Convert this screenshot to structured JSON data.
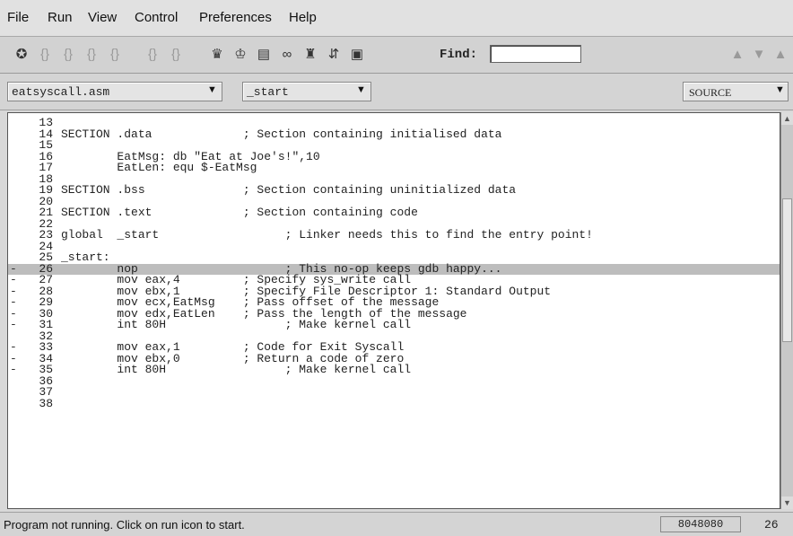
{
  "menu": [
    {
      "label": "File"
    },
    {
      "label": "Run"
    },
    {
      "label": "View"
    },
    {
      "label": "Control"
    },
    {
      "label": "Preferences"
    },
    {
      "label": "Help"
    }
  ],
  "toolbar": {
    "icons": [
      "run-icon",
      "step-icon",
      "step-into-icon",
      "next-icon",
      "until-icon",
      "finish-icon",
      "continue-icon",
      "breakpoint-icon",
      "watch-icon",
      "stack-icon",
      "registers-icon",
      "memory-icon",
      "signal-icon",
      "frame-icon"
    ],
    "find_label": "Find:",
    "find_value": ""
  },
  "selectors": {
    "file": "eatsyscall.asm",
    "function": "_start",
    "view_mode": "SOURCE"
  },
  "source": {
    "current_line": 26,
    "lines": [
      {
        "n": "13",
        "marker": "",
        "text": ""
      },
      {
        "n": "14",
        "marker": "",
        "text": "SECTION .data             ; Section containing initialised data"
      },
      {
        "n": "15",
        "marker": "",
        "text": ""
      },
      {
        "n": "16",
        "marker": "",
        "text": "        EatMsg: db \"Eat at Joe's!\",10"
      },
      {
        "n": "17",
        "marker": "",
        "text": "        EatLen: equ $-EatMsg"
      },
      {
        "n": "18",
        "marker": "",
        "text": ""
      },
      {
        "n": "19",
        "marker": "",
        "text": "SECTION .bss              ; Section containing uninitialized data"
      },
      {
        "n": "20",
        "marker": "",
        "text": ""
      },
      {
        "n": "21",
        "marker": "",
        "text": "SECTION .text             ; Section containing code"
      },
      {
        "n": "22",
        "marker": "",
        "text": ""
      },
      {
        "n": "23",
        "marker": "",
        "text": "global  _start                  ; Linker needs this to find the entry point!"
      },
      {
        "n": "24",
        "marker": "",
        "text": ""
      },
      {
        "n": "25",
        "marker": "",
        "text": "_start:"
      },
      {
        "n": "26",
        "marker": "-",
        "text": "        nop                     ; This no-op keeps gdb happy..."
      },
      {
        "n": "27",
        "marker": "-",
        "text": "        mov eax,4         ; Specify sys_write call"
      },
      {
        "n": "28",
        "marker": "-",
        "text": "        mov ebx,1         ; Specify File Descriptor 1: Standard Output"
      },
      {
        "n": "29",
        "marker": "-",
        "text": "        mov ecx,EatMsg    ; Pass offset of the message"
      },
      {
        "n": "30",
        "marker": "-",
        "text": "        mov edx,EatLen    ; Pass the length of the message"
      },
      {
        "n": "31",
        "marker": "-",
        "text": "        int 80H                 ; Make kernel call"
      },
      {
        "n": "32",
        "marker": "",
        "text": ""
      },
      {
        "n": "33",
        "marker": "-",
        "text": "        mov eax,1         ; Code for Exit Syscall"
      },
      {
        "n": "34",
        "marker": "-",
        "text": "        mov ebx,0         ; Return a code of zero"
      },
      {
        "n": "35",
        "marker": "-",
        "text": "        int 80H                 ; Make kernel call"
      },
      {
        "n": "36",
        "marker": "",
        "text": ""
      },
      {
        "n": "37",
        "marker": "",
        "text": ""
      },
      {
        "n": "38",
        "marker": "",
        "text": ""
      }
    ]
  },
  "status": {
    "message": "Program not running. Click on run icon to start.",
    "address": "8048080",
    "line": "26"
  }
}
